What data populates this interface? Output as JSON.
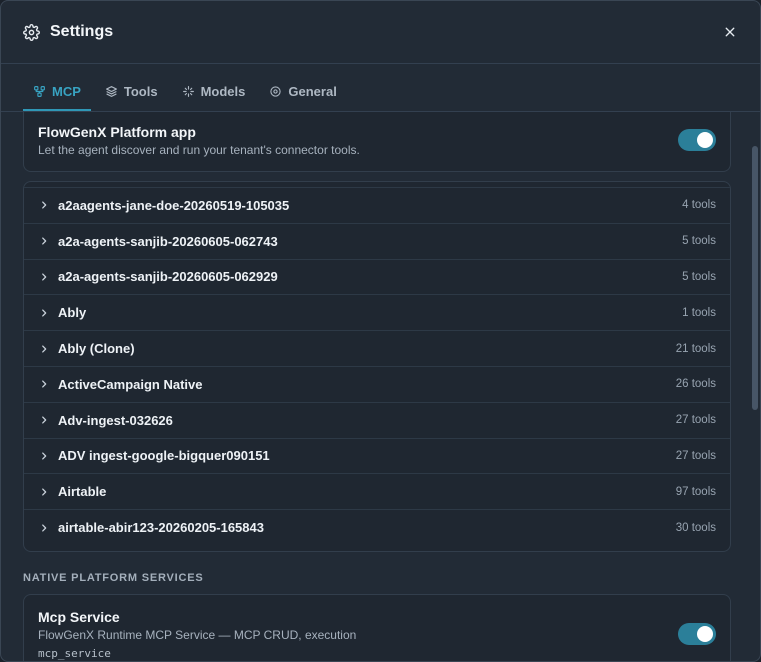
{
  "header": {
    "title": "Settings",
    "gear_icon": "gear-icon",
    "close_icon": "close-icon"
  },
  "tabs": [
    {
      "label": "MCP",
      "icon": "mcp-icon",
      "active": true
    },
    {
      "label": "Tools",
      "icon": "layers-icon",
      "active": false
    },
    {
      "label": "Models",
      "icon": "sparkle-icon",
      "active": false
    },
    {
      "label": "General",
      "icon": "gear-icon",
      "active": false
    }
  ],
  "platform_app": {
    "title": "FlowGenX Platform app",
    "description": "Let the agent discover and run your tenant's connector tools.",
    "enabled": true
  },
  "connectors": [
    {
      "name": "a2aagents-jane-doe-20260519-105035",
      "count": "4 tools"
    },
    {
      "name": "a2a-agents-sanjib-20260605-062743",
      "count": "5 tools"
    },
    {
      "name": "a2a-agents-sanjib-20260605-062929",
      "count": "5 tools"
    },
    {
      "name": "Ably",
      "count": "1 tools"
    },
    {
      "name": "Ably (Clone)",
      "count": "21 tools"
    },
    {
      "name": "ActiveCampaign Native",
      "count": "26 tools"
    },
    {
      "name": "Adv-ingest-032626",
      "count": "27 tools"
    },
    {
      "name": "ADV ingest-google-bigquer090151",
      "count": "27 tools"
    },
    {
      "name": "Airtable",
      "count": "97 tools"
    },
    {
      "name": "airtable-abir123-20260205-165843",
      "count": "30 tools"
    }
  ],
  "native_section": {
    "label": "NATIVE PLATFORM SERVICES"
  },
  "mcp_service": {
    "title": "Mcp Service",
    "description": "FlowGenX Runtime MCP Service — MCP CRUD, execution",
    "id": "mcp_service",
    "enabled": true
  },
  "colors": {
    "accent": "#2f97b6",
    "toggle_on": "#2b7f99",
    "background": "#222b36"
  }
}
